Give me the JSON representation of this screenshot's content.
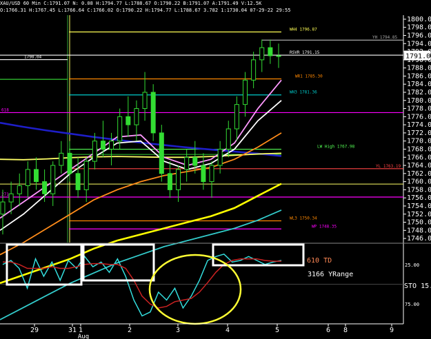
{
  "header": {
    "line1": "XAU/USD 60 Min  C:1791.07  N:  0.08  H:1794.77  L:1788.67  O:1790.22  B:1791.07  A:1791.49  V:12.5K",
    "line2": "O:1766.31  H:1767.45  L:1766.64  C:1766.02  O:1790.22  H:1794.77  L:1788.67  3.782  1:1730.04  07-29-22  29:55"
  },
  "chart_data": [
    {
      "type": "candlestick",
      "title": "",
      "yaxis": {
        "ticks": [
          1746,
          1748,
          1750,
          1752,
          1754,
          1756,
          1758,
          1760,
          1762,
          1764,
          1766,
          1768,
          1770,
          1772,
          1774,
          1776,
          1778,
          1780,
          1782,
          1784,
          1786,
          1788,
          1790,
          1792,
          1794,
          1796,
          1798,
          1800
        ],
        "tick_labels": [
          "1746.00",
          "1748.00",
          "1750.00",
          "1752.00",
          "1754.00",
          "1756.00",
          "1758.00",
          "1760.00",
          "1762.00",
          "1764.00",
          "1766.00",
          "1768.00",
          "1770.00",
          "1772.00",
          "1774.00",
          "1776.00",
          "1778.00",
          "1780.00",
          "1782.00",
          "1784.00",
          "1786.00",
          "1788.00",
          "1790.00",
          "1792.00",
          "1794.00",
          "1796.00",
          "1798.00",
          "1800.00"
        ],
        "range": [
          1745,
          1801
        ]
      },
      "last_price_label": "1791.07",
      "levels": [
        {
          "label": "WH4 1796.87",
          "value": 1796.87,
          "color": "#ffff55"
        },
        {
          "label": "YH 1794.85",
          "value": 1794.85,
          "color": "#aaaaaa"
        },
        {
          "label": "RSVR 1791.15",
          "value": 1791.15,
          "color": "#ffffff"
        },
        {
          "label": "1790.04",
          "value": 1790.04,
          "color": "#ffffff"
        },
        {
          "label": "WR1 1785.30",
          "value": 1785.3,
          "color": "#ff8800"
        },
        {
          "label": "WH3 1781.36",
          "value": 1781.36,
          "color": "#00cccc"
        },
        {
          "label": "618",
          "value": 1777.0,
          "color": "#ff00ff"
        },
        {
          "label": "LW High 1767.98",
          "value": 1767.98,
          "color": "#55ff55"
        },
        {
          "label": "YL 1763.19",
          "value": 1763.19,
          "color": "#ff4444"
        },
        {
          "label": "WL3 1750.34",
          "value": 1750.34,
          "color": "#ff8800"
        },
        {
          "label": "WP 1748.35",
          "value": 1748.35,
          "color": "#ff00ff"
        },
        {
          "label": "271",
          "value": 1756.2,
          "color": "#ff00ff"
        }
      ],
      "candles": {
        "ohlc": [
          [
            1752,
            1758,
            1747,
            1755
          ],
          [
            1755,
            1760,
            1752,
            1757
          ],
          [
            1757,
            1762,
            1754,
            1759
          ],
          [
            1759,
            1765,
            1756,
            1763
          ],
          [
            1763,
            1766,
            1758,
            1760
          ],
          [
            1760,
            1763,
            1755,
            1757
          ],
          [
            1757,
            1765,
            1754,
            1764
          ],
          [
            1764,
            1770,
            1762,
            1767
          ],
          [
            1767,
            1770,
            1760,
            1762
          ],
          [
            1762,
            1766,
            1756,
            1758
          ],
          [
            1758,
            1766,
            1755,
            1765
          ],
          [
            1765,
            1772,
            1763,
            1770
          ],
          [
            1770,
            1775,
            1766,
            1768
          ],
          [
            1768,
            1772,
            1764,
            1770
          ],
          [
            1770,
            1778,
            1768,
            1776
          ],
          [
            1776,
            1781,
            1771,
            1774
          ],
          [
            1774,
            1780,
            1770,
            1778
          ],
          [
            1778,
            1787,
            1775,
            1782
          ],
          [
            1782,
            1784,
            1770,
            1772
          ],
          [
            1772,
            1774,
            1760,
            1762
          ],
          [
            1762,
            1765,
            1756,
            1758
          ],
          [
            1758,
            1764,
            1755,
            1763
          ],
          [
            1763,
            1768,
            1760,
            1766
          ],
          [
            1766,
            1770,
            1762,
            1764
          ],
          [
            1764,
            1767,
            1758,
            1760
          ],
          [
            1760,
            1765,
            1756,
            1764
          ],
          [
            1764,
            1770,
            1762,
            1768
          ],
          [
            1768,
            1775,
            1766,
            1773
          ],
          [
            1773,
            1781,
            1770,
            1779
          ],
          [
            1779,
            1787,
            1776,
            1785
          ],
          [
            1785,
            1792,
            1783,
            1790
          ],
          [
            1790,
            1795,
            1787,
            1793
          ],
          [
            1793,
            1795,
            1789,
            1791
          ],
          [
            1791,
            1794,
            1788,
            1791
          ]
        ]
      },
      "moving_averages": [
        {
          "color": "#1e1ec8",
          "values": [
            1774.5,
            1773.5,
            1772.6,
            1771.8,
            1771.0,
            1770.3,
            1769.6,
            1769.0,
            1768.4,
            1767.9,
            1767.4,
            1766.9,
            1766.3
          ]
        },
        {
          "color": "#ffff66",
          "values": [
            1765.5,
            1765.4,
            1765.6,
            1765.9,
            1766.1,
            1766.2,
            1766.1,
            1766.0,
            1766.0,
            1766.2,
            1766.5,
            1766.8,
            1767.0
          ]
        },
        {
          "color": "#ff8c1a",
          "values": [
            1742.0,
            1745.0,
            1748.5,
            1752.0,
            1755.5,
            1758.0,
            1760.0,
            1761.5,
            1762.5,
            1763.5,
            1765.5,
            1768.5,
            1772.0
          ]
        },
        {
          "color": "#ffff00",
          "values": [
            1735.0,
            1737.0,
            1739.0,
            1741.0,
            1743.5,
            1745.5,
            1747.0,
            1748.5,
            1750.0,
            1751.5,
            1753.5,
            1756.5,
            1759.5
          ]
        },
        {
          "color": "#ffffff",
          "values": [
            1748.0,
            1752.0,
            1757.0,
            1762.0,
            1766.0,
            1769.5,
            1770.0,
            1765.0,
            1763.0,
            1764.5,
            1768.0,
            1775.0,
            1780.0
          ]
        },
        {
          "color": "#ff99ff",
          "values": [
            1751.0,
            1755.0,
            1759.0,
            1763.0,
            1767.0,
            1771.0,
            1771.5,
            1766.0,
            1764.0,
            1765.5,
            1769.5,
            1778.0,
            1785.0
          ]
        },
        {
          "color": "#33cccc",
          "values": [
            1726.0,
            1729.0,
            1732.0,
            1735.0,
            1737.5,
            1740.0,
            1742.0,
            1744.0,
            1745.5,
            1747.0,
            1748.5,
            1750.5,
            1753.0
          ]
        }
      ]
    },
    {
      "type": "line",
      "title": "",
      "yaxis": {
        "tick_labels": [
          "25.00",
          "STO 15.0",
          "75.00"
        ]
      },
      "annotations": [
        "610 TD",
        "3166 YRange"
      ],
      "series": [
        {
          "color": "#33dddd",
          "values": [
            25,
            20,
            30,
            55,
            18,
            40,
            22,
            45,
            20,
            30,
            15,
            28,
            22,
            35,
            18,
            40,
            70,
            90,
            85,
            60,
            70,
            55,
            80,
            65,
            45,
            20,
            15,
            12,
            22,
            20,
            15,
            20,
            25,
            22,
            20
          ]
        },
        {
          "color": "#cc2222",
          "values": [
            22,
            22,
            25,
            30,
            30,
            30,
            28,
            30,
            30,
            28,
            25,
            24,
            24,
            25,
            25,
            30,
            45,
            65,
            75,
            80,
            78,
            72,
            70,
            68,
            60,
            48,
            35,
            25,
            20,
            18,
            18,
            18,
            20,
            21,
            21
          ]
        }
      ]
    }
  ],
  "xaxis": {
    "tick_labels": [
      "29",
      "31",
      "1",
      "2",
      "3",
      "4",
      "5",
      "6",
      "8",
      "9"
    ],
    "month_label": "Aug"
  }
}
